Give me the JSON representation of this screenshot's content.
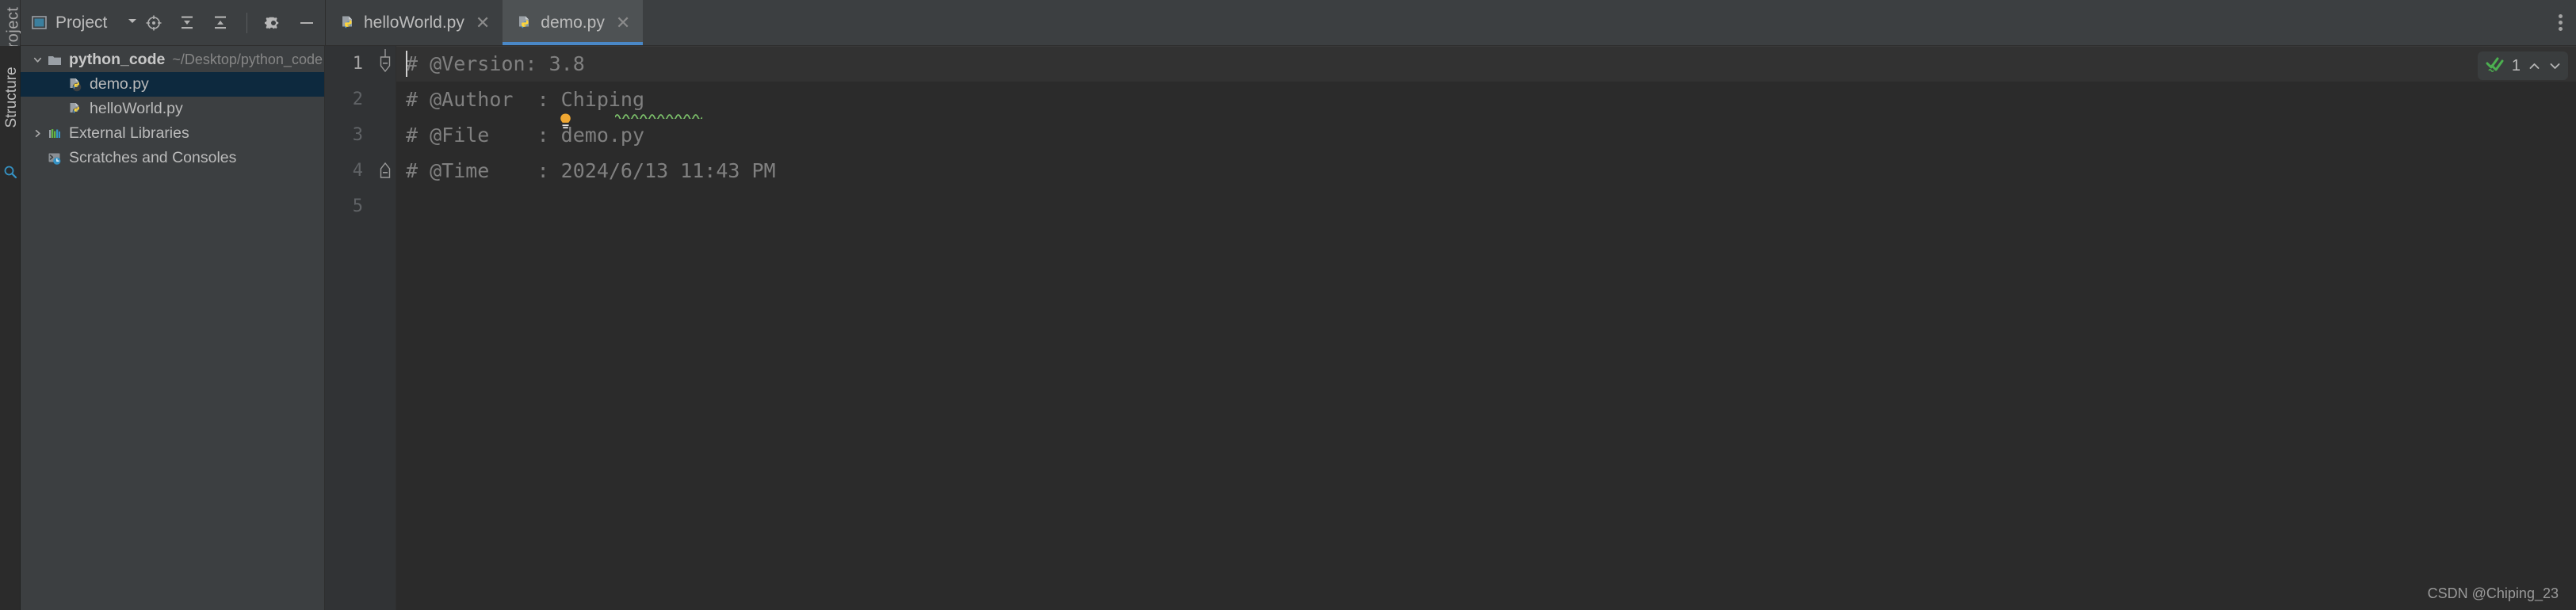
{
  "toolwindow": {
    "strip_label": "Project",
    "strip_icon": "structure-icon",
    "left_strip_label": "Structure"
  },
  "panel": {
    "icon": "project-panel-icon",
    "title": "Project",
    "caret_icon": "chevron-down-icon",
    "actions": [
      {
        "name": "locate-file-icon",
        "label": "Select Opened File"
      },
      {
        "name": "expand-all-icon",
        "label": "Expand All"
      },
      {
        "name": "collapse-all-icon",
        "label": "Collapse All"
      },
      {
        "name": "gear-icon",
        "label": "Options"
      },
      {
        "name": "minimize-icon",
        "label": "Hide"
      }
    ]
  },
  "tabs": {
    "items": [
      {
        "label": "helloWorld.py",
        "icon": "python-file-icon",
        "active": false,
        "close_glyph": "✕"
      },
      {
        "label": "demo.py",
        "icon": "python-file-icon",
        "active": true,
        "close_glyph": "✕"
      }
    ],
    "overflow_icon": "more-vertical-icon"
  },
  "tree": {
    "rows": [
      {
        "name": "tree-row-python-code",
        "twisty": "chevron-down-icon",
        "icon": "folder-icon",
        "label": "python_code",
        "sub": "~/Desktop/python_code",
        "bold": true,
        "indent": 0,
        "selected": false
      },
      {
        "name": "tree-row-demo-py",
        "twisty": "",
        "icon": "python-file-icon",
        "label": "demo.py",
        "sub": "",
        "bold": false,
        "indent": 26,
        "selected": true
      },
      {
        "name": "tree-row-helloworld-py",
        "twisty": "",
        "icon": "python-file-icon",
        "label": "helloWorld.py",
        "sub": "",
        "bold": false,
        "indent": 26,
        "selected": false
      },
      {
        "name": "tree-row-external-libraries",
        "twisty": "chevron-right-icon",
        "icon": "external-libraries-icon",
        "label": "External Libraries",
        "sub": "",
        "bold": false,
        "indent": 0,
        "selected": false
      },
      {
        "name": "tree-row-scratches-and-consoles",
        "twisty": "",
        "icon": "scratches-icon",
        "label": "Scratches and Consoles",
        "sub": "",
        "bold": false,
        "indent": 0,
        "selected": false
      }
    ]
  },
  "editor": {
    "line_numbers": [
      "1",
      "2",
      "3",
      "4",
      "5"
    ],
    "current_line": 1,
    "lines": [
      {
        "num": "1",
        "text": "# @Version: 3.8",
        "current": true,
        "bulb": false,
        "fold": "fold-start"
      },
      {
        "num": "2",
        "text": "# @Author  : Chiping",
        "current": false,
        "bulb": true,
        "fold": ""
      },
      {
        "num": "3",
        "text": "# @File    : demo.py",
        "current": false,
        "bulb": false,
        "fold": ""
      },
      {
        "num": "4",
        "text": "# @Time    : 2024/6/13 11:43 PM",
        "current": false,
        "bulb": false,
        "fold": "fold-end"
      },
      {
        "num": "5",
        "text": "",
        "current": false,
        "bulb": false,
        "fold": ""
      }
    ],
    "misspelled_word": "Chiping",
    "bulb_icon": "lightbulb-icon"
  },
  "inspection": {
    "icon": "inspection-ok-icon",
    "count": "1",
    "prev_icon": "chevron-up-icon",
    "next_icon": "chevron-down-icon"
  },
  "watermark": "CSDN @Chiping_23",
  "colors": {
    "accent_blue": "#4a88c7",
    "selection_navy": "#0d293e",
    "panel_bg": "#3c3f41",
    "editor_bg": "#2b2b2b",
    "gutter_bg": "#313335",
    "text": "#bbbbbb",
    "comment": "#808080",
    "bulb_yellow": "#f0a732",
    "spell_green": "#7bbf6a",
    "inspect_green": "#4caf50"
  }
}
